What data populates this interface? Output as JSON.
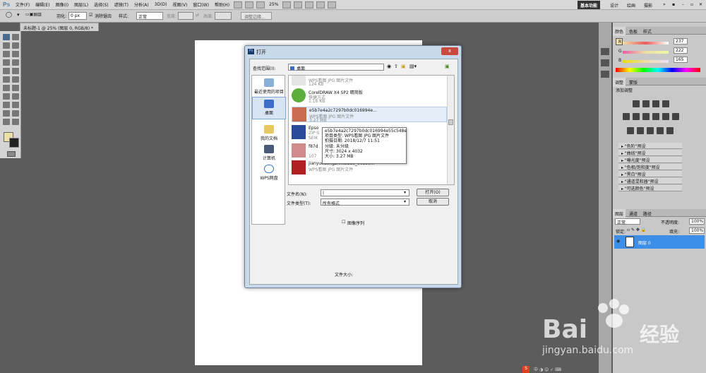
{
  "app": {
    "logo": "Ps"
  },
  "menu": [
    "文件(F)",
    "编辑(E)",
    "图像(I)",
    "图层(L)",
    "选择(S)",
    "滤镜(T)",
    "分析(A)",
    "3D(D)",
    "视图(V)",
    "窗口(W)",
    "帮助(H)"
  ],
  "zoom": "25%",
  "workspaces": [
    "基本功能",
    "设计",
    "绘画",
    "摄影"
  ],
  "options": {
    "feather_label": "羽化:",
    "feather_value": "0 px",
    "antialias": "消除锯齿",
    "style_label": "样式:",
    "style_value": "正常",
    "width_label": "宽度:",
    "height_label": "高度:",
    "refine_edge": "调整边缘..."
  },
  "document_tab": "未标题-1 @ 25% (图层 0, RGB/8) *",
  "panels": {
    "color_tabs": [
      "颜色",
      "色板",
      "样式"
    ],
    "channels": [
      {
        "label": "R",
        "value": "237",
        "color": "#ed5a5a"
      },
      {
        "label": "G",
        "value": "222",
        "color": "#4cb84c"
      },
      {
        "label": "B",
        "value": "165",
        "color": "#5a5aed"
      }
    ],
    "adjust_tabs": [
      "调整",
      "蒙版"
    ],
    "adjust_title": "添加调整",
    "presets": [
      "\"色阶\"预设",
      "\"曲线\"预设",
      "\"曝光度\"预设",
      "\"色相/饱和度\"预设",
      "\"黑白\"预设",
      "\"通道混和器\"预设",
      "\"可选颜色\"预设"
    ],
    "layers_tabs": [
      "图层",
      "通道",
      "路径"
    ],
    "blend_mode": "正常",
    "opacity_label": "不透明度:",
    "opacity_value": "100%",
    "lock_label": "锁定:",
    "fill_label": "填充:",
    "fill_value": "100%",
    "layer_name": "图层 0"
  },
  "colors": {
    "foreground": "#ede0a5",
    "layer_selected": "#3c8ee6"
  },
  "dialog": {
    "title_icon": "Ps",
    "title": "打开",
    "close": "x",
    "lookin_label": "查找范围(I):",
    "lookin_value": "桌面",
    "places": [
      "最近使用的项目",
      "桌面",
      "我的文档",
      "计算机",
      "WPS网盘"
    ],
    "files": [
      {
        "name": "",
        "type": "WPS看图 JPG 图片文件",
        "size": "124 KB"
      },
      {
        "name": "CorelDRAW X4 SP2 精简版",
        "type": "快捷方式",
        "size": "1.16 KB"
      },
      {
        "name": "e5b7e4a2c7297b0dc016994e...",
        "type": "WPS看图 JPG 图片文件",
        "size": "3.27 MB"
      },
      {
        "name": "Epso",
        "type": "ZIP S",
        "size": "SEIK"
      },
      {
        "name": "f87d",
        "type": "",
        "size": "107"
      },
      {
        "name": "jianyuedongzhihaibao_90350...",
        "type": "WPS看图 JPG 图片文件",
        "size": ""
      }
    ],
    "tooltip": [
      "e5b7e4a2c7297b0dc016994e55c548e",
      "项目类型: WPS看图 JPG 图片文件",
      "拍摄日期: 2018/12/7 11:51",
      "分级: 未分级",
      "尺寸: 3024 x 4032",
      "大小: 3.27 MB"
    ],
    "filename_label": "文件名(N):",
    "filename_value": "|",
    "filetype_label": "文件类型(T):",
    "filetype_value": "所有格式",
    "open_button": "打开(O)",
    "cancel_button": "取消",
    "image_sequence": "图像序列",
    "filesize_label": "文件大小:"
  },
  "watermark": {
    "brand": "Bai",
    "brand2": "经验",
    "url": "jingyan.baidu.com"
  }
}
